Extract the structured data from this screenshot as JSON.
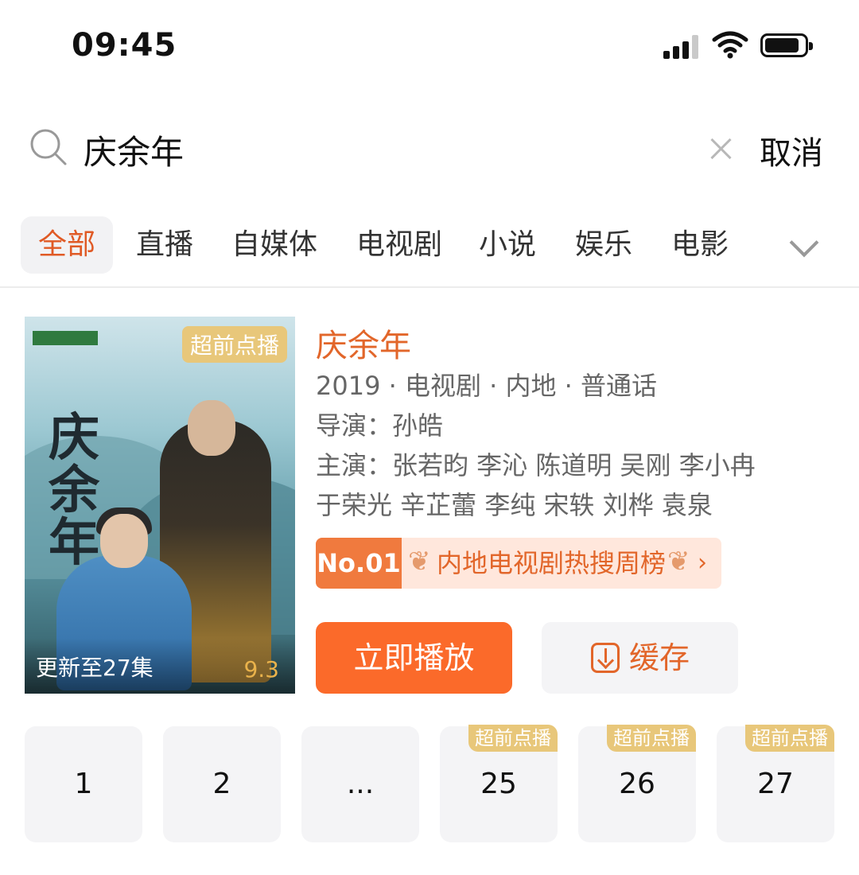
{
  "status_bar": {
    "time": "09:45"
  },
  "search": {
    "query": "庆余年",
    "cancel_label": "取消"
  },
  "tabs": [
    {
      "label": "全部"
    },
    {
      "label": "直播"
    },
    {
      "label": "自媒体"
    },
    {
      "label": "电视剧"
    },
    {
      "label": "小说"
    },
    {
      "label": "娱乐"
    },
    {
      "label": "电影"
    }
  ],
  "result": {
    "poster": {
      "badge": "超前点播",
      "update_text": "更新至27集",
      "score": "9.3"
    },
    "title": "庆余年",
    "meta": "2019 · 电视剧 · 内地 · 普通话",
    "director": "导演：孙皓",
    "cast_line1": "主演：张若昀  李沁  陈道明  吴刚  李小冉",
    "cast_line2": "于荣光  辛芷蕾  李纯  宋轶  刘桦  袁泉",
    "rank": {
      "number": "No.01",
      "label": "内地电视剧热搜周榜",
      "arrow": "›"
    },
    "play_label": "立即播放",
    "cache_label": "缓存"
  },
  "episodes": [
    {
      "label": "1",
      "badge": ""
    },
    {
      "label": "2",
      "badge": ""
    },
    {
      "label": "...",
      "badge": ""
    },
    {
      "label": "25",
      "badge": "超前点播"
    },
    {
      "label": "26",
      "badge": "超前点播"
    },
    {
      "label": "27",
      "badge": "超前点播"
    }
  ],
  "colors": {
    "accent": "#fb6a2a",
    "title": "#e2662a",
    "badge_gold": "#e8c77a"
  }
}
